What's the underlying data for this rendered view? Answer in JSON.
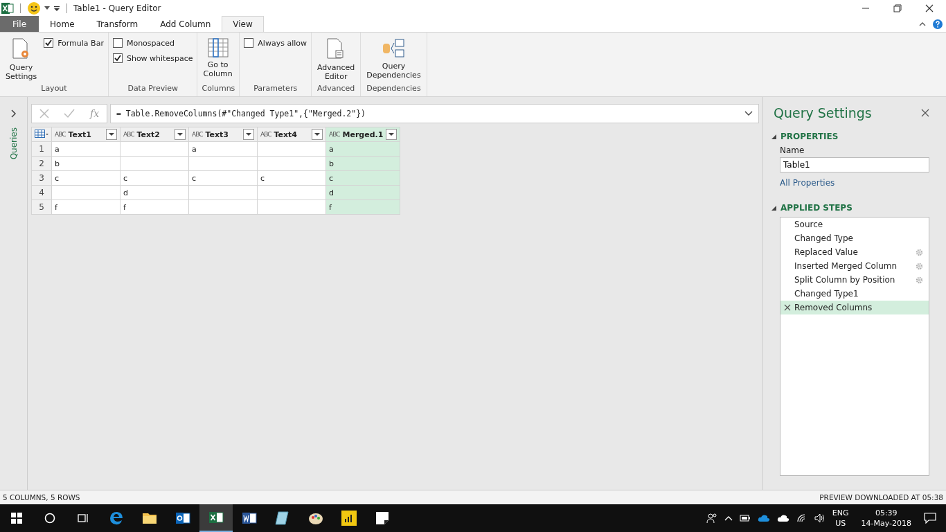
{
  "window": {
    "title": "Table1 - Query Editor"
  },
  "ribbon_tabs": [
    {
      "label": "File",
      "kind": "file",
      "selected": false
    },
    {
      "label": "Home",
      "kind": "tab",
      "selected": false
    },
    {
      "label": "Transform",
      "kind": "tab",
      "selected": false
    },
    {
      "label": "Add Column",
      "kind": "tab",
      "selected": false
    },
    {
      "label": "View",
      "kind": "tab",
      "selected": true
    }
  ],
  "ribbon_groups": [
    {
      "label": "Layout",
      "items": [
        {
          "kind": "settings_button",
          "label": "Query\nSettings"
        },
        {
          "kind": "checkbox",
          "label": "Formula Bar",
          "checked": true
        }
      ]
    },
    {
      "label": "Data Preview",
      "items": [
        {
          "kind": "checkbox",
          "label": "Monospaced",
          "checked": false
        },
        {
          "kind": "checkbox",
          "label": "Show whitespace",
          "checked": true
        }
      ]
    },
    {
      "label": "Columns",
      "items": [
        {
          "kind": "column_button",
          "label": "Go to\nColumn"
        }
      ]
    },
    {
      "label": "Parameters",
      "items": [
        {
          "kind": "checkbox",
          "label": "Always allow",
          "checked": false
        }
      ]
    },
    {
      "label": "Advanced",
      "items": [
        {
          "kind": "editor_button",
          "label": "Advanced\nEditor"
        }
      ]
    },
    {
      "label": "Dependencies",
      "items": [
        {
          "kind": "dependencies_button",
          "label": "Query\nDependencies"
        }
      ]
    }
  ],
  "queries_pane": {
    "label": "Queries"
  },
  "formula_bar": {
    "fx": "fx",
    "formula": "= Table.RemoveColumns(#\"Changed Type1\",{\"Merged.2\"})"
  },
  "table": {
    "columns": [
      {
        "type": "ABC",
        "name": "Text1",
        "selected": false
      },
      {
        "type": "ABC",
        "name": "Text2",
        "selected": false
      },
      {
        "type": "ABC",
        "name": "Text3",
        "selected": false
      },
      {
        "type": "ABC",
        "name": "Text4",
        "selected": false
      },
      {
        "type": "ABC",
        "name": "Merged.1",
        "selected": true
      }
    ],
    "rows": [
      {
        "number": "1",
        "cells": [
          "a",
          "",
          "a",
          "",
          "a"
        ]
      },
      {
        "number": "2",
        "cells": [
          "b",
          "",
          "",
          "",
          "b"
        ]
      },
      {
        "number": "3",
        "cells": [
          "c",
          "c",
          "c",
          "c",
          "c"
        ]
      },
      {
        "number": "4",
        "cells": [
          "",
          "d",
          "",
          "",
          "d"
        ]
      },
      {
        "number": "5",
        "cells": [
          "f",
          "f",
          "",
          "",
          "f"
        ]
      }
    ]
  },
  "query_settings": {
    "title": "Query Settings",
    "properties_heading": "PROPERTIES",
    "name_label": "Name",
    "name_value": "Table1",
    "all_properties_link": "All Properties",
    "steps_heading": "APPLIED STEPS",
    "steps": [
      {
        "label": "Source",
        "has_settings": false,
        "selected": false
      },
      {
        "label": "Changed Type",
        "has_settings": false,
        "selected": false
      },
      {
        "label": "Replaced Value",
        "has_settings": true,
        "selected": false
      },
      {
        "label": "Inserted Merged Column",
        "has_settings": true,
        "selected": false
      },
      {
        "label": "Split Column by Position",
        "has_settings": true,
        "selected": false
      },
      {
        "label": "Changed Type1",
        "has_settings": false,
        "selected": false
      },
      {
        "label": "Removed Columns",
        "has_settings": false,
        "selected": true
      }
    ]
  },
  "status_bar": {
    "left": "5 COLUMNS, 5 ROWS",
    "right": "PREVIEW DOWNLOADED AT 05:38"
  },
  "taskbar": {
    "apps": [
      {
        "kind": "edge",
        "active": false
      },
      {
        "kind": "explorer",
        "active": false
      },
      {
        "kind": "outlook",
        "active": false
      },
      {
        "kind": "excel",
        "active": true
      },
      {
        "kind": "word",
        "active": false
      },
      {
        "kind": "notebook",
        "active": false
      },
      {
        "kind": "paint",
        "active": false
      },
      {
        "kind": "powerbi",
        "active": false
      },
      {
        "kind": "notes",
        "active": false
      }
    ],
    "language": "ENG",
    "region": "US",
    "time": "05:39",
    "date": "14-May-2018"
  }
}
